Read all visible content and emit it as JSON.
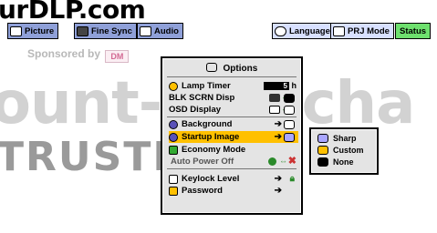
{
  "watermarks": {
    "top": "urDLP.com",
    "sponsored": "Sponsored by",
    "sponsor_logo": "DM",
    "big_left": "ount-",
    "big_right": "rcha",
    "trusted": "TRUSTED"
  },
  "toolbar": {
    "picture": "Picture",
    "fine_sync": "Fine Sync",
    "audio": "Audio",
    "language": "Language",
    "prj_mode": "PRJ Mode",
    "status": "Status"
  },
  "osd": {
    "title": "Options",
    "items": [
      {
        "label": "Lamp Timer",
        "value": "5",
        "unit": "h"
      },
      {
        "label": "BLK SCRN Disp"
      },
      {
        "label": "OSD Display"
      },
      {
        "label": "Background"
      },
      {
        "label": "Startup Image"
      },
      {
        "label": "Economy Mode"
      },
      {
        "label": "Auto Power Off"
      },
      {
        "label": "Keylock Level"
      },
      {
        "label": "Password"
      }
    ]
  },
  "submenu": {
    "items": [
      "Sharp",
      "Custom",
      "None"
    ]
  },
  "colors": {
    "selected_row": "#ffc000",
    "active_tab": "#6ee06e",
    "tab": "#8fa0d8",
    "swatch": "#a9a6ff"
  }
}
